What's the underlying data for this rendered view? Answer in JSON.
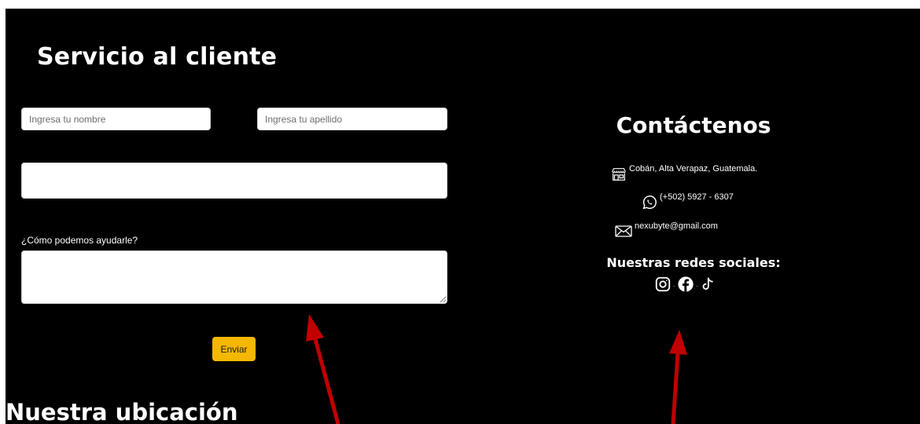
{
  "form": {
    "title": "Servicio al cliente",
    "first_name_placeholder": "Ingresa tu nombre",
    "last_name_placeholder": "Ingresa tu apellido",
    "email_placeholder": "",
    "message_label": "¿Cómo podemos ayudarle?",
    "send_label": "Enviar"
  },
  "contact": {
    "title": "Contáctenos",
    "address": "Cobán, Alta Verapaz, Guatemala.",
    "phone": "(+502) 5927 - 6307",
    "email": "nexubyte@gmail.com",
    "social_title": "Nuestras redes sociales:",
    "social_icons": [
      "instagram-icon",
      "facebook-icon",
      "tiktok-icon"
    ],
    "social_separator": "-"
  },
  "location": {
    "title": "Nuestra ubicación"
  },
  "colors": {
    "background": "#000000",
    "text": "#ffffff",
    "send_button": "#f5b800",
    "annotation_arrow": "#c00000"
  },
  "annotations": [
    "arrow-pointing-up",
    "arrow-pointing-up"
  ]
}
